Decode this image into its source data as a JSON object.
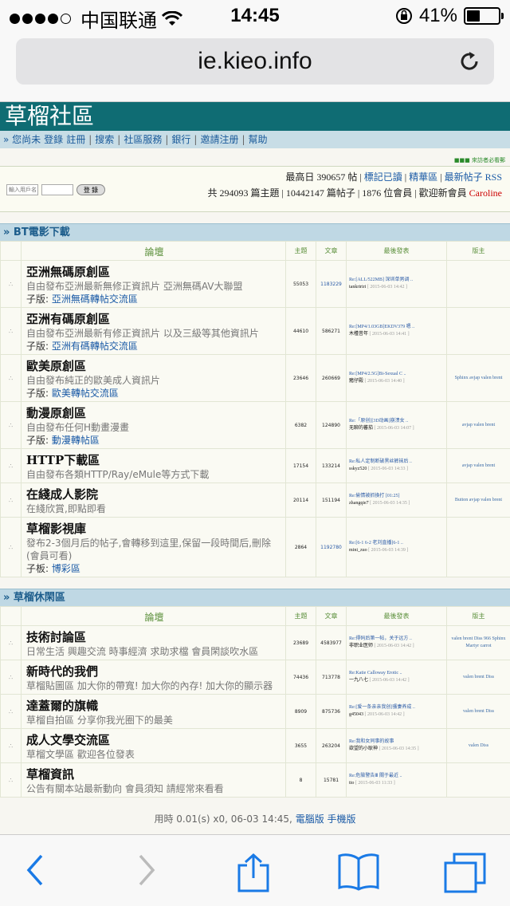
{
  "status": {
    "carrier": "中国联通",
    "time": "14:45",
    "battery": "41%",
    "battery_level": 0.41
  },
  "browser": {
    "url": "ie.kieo.info"
  },
  "site": {
    "title": "草榴社區",
    "nav": [
      "» 您尚未",
      "登錄",
      "註冊",
      "|",
      "搜索",
      "|",
      "社區服務",
      "|",
      "銀行",
      "|",
      "邀請注册",
      "|",
      "幫助"
    ],
    "notice": "■■■ 來訪者必看郵"
  },
  "login": {
    "user_placeholder": "輸入用戶名",
    "button": "登 錄"
  },
  "stats": {
    "line1_prefix": "最高日 390657 帖 |",
    "link1": "標記已讀",
    "sep": "|",
    "link2": "精華區",
    "link3": "最新帖子",
    "link4": "RSS",
    "line2": "共 294093 篇主題 | 10442147 篇帖子 | 1876 位會員 | 歡迎新會員",
    "newest_member": "Caroline"
  },
  "headers": {
    "forum": "論壇",
    "topics": "主題",
    "posts": "文章",
    "last": "最後發表",
    "mods": "版主"
  },
  "sections": [
    {
      "title": "» BT電影下載",
      "forums": [
        {
          "name": "亞洲無碼原創區",
          "desc": "自由發布亞洲最新無修正資訊片 亞洲無碼AV大聯盟",
          "sub_label": "子版:",
          "sub": "亞洲無碼轉帖交流區",
          "topics": "55053",
          "posts": "1183229",
          "last_title": "Re:[ALL/522MB] 深圳单男调 ..",
          "last_user": "tankririri",
          "last_date": "[ 2015-06-03 14:42 ]",
          "mods": ""
        },
        {
          "name": "亞洲有碼原創區",
          "desc": "自由發布亞洲最新有修正資訊片 以及三級等其他資訊片",
          "sub_label": "子版:",
          "sub": "亞洲有碼轉帖交流區",
          "topics": "44610",
          "posts": "586271",
          "last_title": "Re:[MP4/1.03GB]EKDV379 嗯 ..",
          "last_user": "木槿昔年",
          "last_date": "[ 2015-06-03 14:41 ]",
          "mods": ""
        },
        {
          "name": "歐美原創區",
          "desc": "自由發布純正的歐美成人資訊片",
          "sub_label": "子版:",
          "sub": "歐美轉帖交流區",
          "topics": "23646",
          "posts": "260669",
          "last_title": "Re:[MP4/2.5G]Bi-Sexual C ..",
          "last_user": "豬仔殿",
          "last_date": "[ 2015-06-03 14:40 ]",
          "mods": "Sphinx avjap valen brent"
        },
        {
          "name": "動漫原創區",
          "desc": "自由發布任何H動畫漫畫",
          "sub_label": "子版:",
          "sub": "動漫轉帖區",
          "topics": "6382",
          "posts": "124890",
          "last_title": "Re:「原创][3D动画]崩溃女 ..",
          "last_user": "无聊的蕃茄",
          "last_date": "[ 2015-06-03 14:07 ]",
          "mods": "avjap valen brent"
        },
        {
          "name": "HTTP下載區",
          "desc": "自由發布各類HTTP/Ray/eMule等方式下載",
          "sub_label": "",
          "sub": "",
          "topics": "17154",
          "posts": "133214",
          "last_title": "Re:私人定制断破黑丝裤袜后 ..",
          "last_user": "sskyz520",
          "last_date": "[ 2015-06-03 14:33 ]",
          "mods": "avjap valen brent"
        },
        {
          "name": "在綫成人影院",
          "desc": "在綫欣賞,即點即看",
          "sub_label": "",
          "sub": "",
          "topics": "20114",
          "posts": "151194",
          "last_title": "Re:偷情被抓換打 [01:25]",
          "last_user": "zhangqie7",
          "last_date": "[ 2015-06-03 14:35 ]",
          "mods": "Button avjap valen brent"
        },
        {
          "name": "草榴影視庫",
          "desc": "發布2-3個月后的帖子,會轉移到這里,保留一段時間后,刪除(會員可看)",
          "sub_label": "子板:",
          "sub": "博彩區",
          "topics": "2864",
          "posts": "1192780",
          "last_title": "Re:[6-1 6-2 老刘直播]6-1 ..",
          "last_user": "mini_zuo",
          "last_date": "[ 2015-06-03 14:39 ]",
          "mods": ""
        }
      ]
    },
    {
      "title": "» 草榴休閑區",
      "forums": [
        {
          "name": "技術討論區",
          "desc": "日常生活 興趣交流 時事經濟 求助求檔 會員閑談吹水區",
          "sub_label": "",
          "sub": "",
          "topics": "23689",
          "posts": "4583977",
          "last_title": "Re:得码后第一帖，关于远方 ..",
          "last_user": "非职业医师",
          "last_date": "[ 2015-06-03 14:42 ]",
          "mods": "valen brent Diss 966 Sphinx Martyr carrot"
        },
        {
          "name": "新時代的我們",
          "desc": "草榴貼圖區 加大你的帶寬! 加大你的內存! 加大你的顯示器",
          "sub_label": "",
          "sub": "",
          "topics": "74436",
          "posts": "713778",
          "last_title": "Re:Katie Calloway Erotic ..",
          "last_user": "一九八七",
          "last_date": "[ 2015-06-03 14:42 ]",
          "mods": "valen brent Diss"
        },
        {
          "name": "達蓋爾的旗幟",
          "desc": "草榴自拍區 分享你我光圈下的最美",
          "sub_label": "",
          "sub": "",
          "topics": "8909",
          "posts": "875736",
          "last_title": "Re:[爱一条亲亲我创]骚妻养成 ..",
          "last_user": "g45043",
          "last_date": "[ 2015-06-03 14:42 ]",
          "mods": "valen brent Diss"
        },
        {
          "name": "成人文學交流區",
          "desc": "草榴文學區 歡迎各位發表",
          "sub_label": "",
          "sub": "",
          "topics": "3655",
          "posts": "263204",
          "last_title": "Re:我和女同事的故事",
          "last_user": "欲望的小耿神",
          "last_date": "[ 2015-06-03 14:35 ]",
          "mods": "valen Diss"
        },
        {
          "name": "草榴資訊",
          "desc": "公告有關本站最新動向 會員須知 請經常來看看",
          "sub_label": "",
          "sub": "",
          "topics": "8",
          "posts": "15781",
          "last_title": "Re:危險警告Ⅲ 關于最近 ..",
          "last_user": "tto",
          "last_date": "[ 2015-06-03 11:33 ]",
          "mods": ""
        }
      ]
    }
  ],
  "footer": {
    "text": "用時 0.01(s) x0, 06-03 14:45,",
    "desktop": "電腦版",
    "mobile": "手機版"
  },
  "colors": {
    "header_bg": "#0f6c73",
    "nav_bg": "#c8dde6",
    "section_bg": "#bfd8e4",
    "link": "#1a5aa6"
  },
  "toolbar_icons": [
    "back-icon",
    "forward-icon",
    "share-icon",
    "bookmarks-icon",
    "tabs-icon"
  ]
}
